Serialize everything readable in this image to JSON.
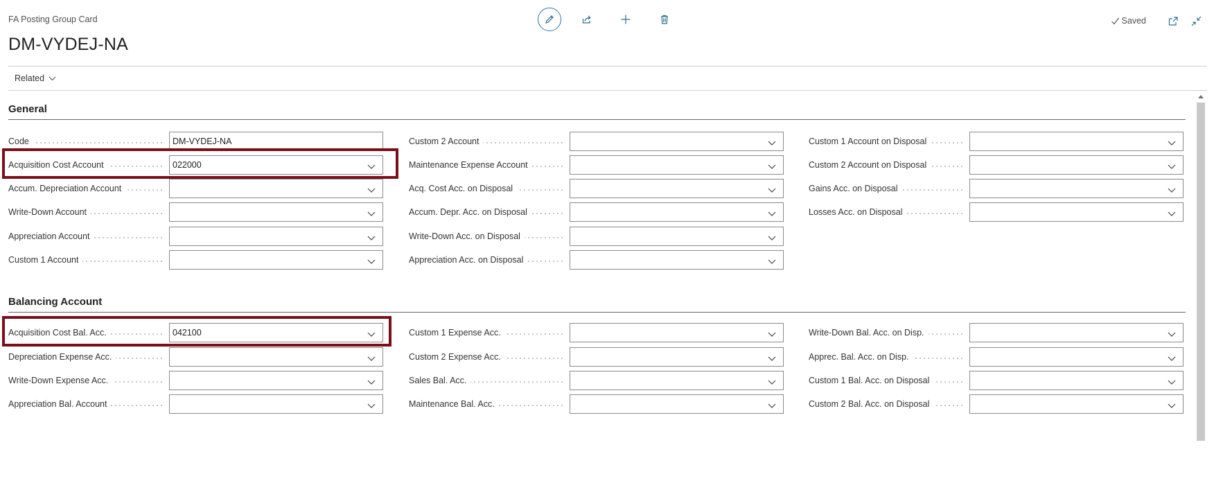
{
  "header": {
    "caption": "FA Posting Group Card",
    "title": "DM-VYDEJ-NA",
    "saved_label": "Saved"
  },
  "nav": {
    "related_label": "Related"
  },
  "general": {
    "title": "General",
    "col1": [
      {
        "label": "Code",
        "value": "DM-VYDEJ-NA",
        "dropdown": false
      },
      {
        "label": "Acquisition Cost Account",
        "value": "022000",
        "dropdown": true
      },
      {
        "label": "Accum. Depreciation Account",
        "value": "",
        "dropdown": true
      },
      {
        "label": "Write-Down Account",
        "value": "",
        "dropdown": true
      },
      {
        "label": "Appreciation Account",
        "value": "",
        "dropdown": true
      },
      {
        "label": "Custom 1 Account",
        "value": "",
        "dropdown": true
      }
    ],
    "col2": [
      {
        "label": "Custom 2 Account",
        "value": "",
        "dropdown": true
      },
      {
        "label": "Maintenance Expense Account",
        "value": "",
        "dropdown": true
      },
      {
        "label": "Acq. Cost Acc. on Disposal",
        "value": "",
        "dropdown": true
      },
      {
        "label": "Accum. Depr. Acc. on Disposal",
        "value": "",
        "dropdown": true
      },
      {
        "label": "Write-Down Acc. on Disposal",
        "value": "",
        "dropdown": true
      },
      {
        "label": "Appreciation Acc. on Disposal",
        "value": "",
        "dropdown": true
      }
    ],
    "col3": [
      {
        "label": "Custom 1 Account on Disposal",
        "value": "",
        "dropdown": true
      },
      {
        "label": "Custom 2 Account on Disposal",
        "value": "",
        "dropdown": true
      },
      {
        "label": "Gains Acc. on Disposal",
        "value": "",
        "dropdown": true
      },
      {
        "label": "Losses Acc. on Disposal",
        "value": "",
        "dropdown": true
      }
    ]
  },
  "balancing": {
    "title": "Balancing Account",
    "col1": [
      {
        "label": "Acquisition Cost Bal. Acc.",
        "value": "042100",
        "dropdown": true
      },
      {
        "label": "Depreciation Expense Acc.",
        "value": "",
        "dropdown": true
      },
      {
        "label": "Write-Down Expense Acc.",
        "value": "",
        "dropdown": true
      },
      {
        "label": "Appreciation Bal. Account",
        "value": "",
        "dropdown": true
      }
    ],
    "col2": [
      {
        "label": "Custom 1 Expense Acc.",
        "value": "",
        "dropdown": true
      },
      {
        "label": "Custom 2 Expense Acc.",
        "value": "",
        "dropdown": true
      },
      {
        "label": "Sales Bal. Acc.",
        "value": "",
        "dropdown": true
      },
      {
        "label": "Maintenance Bal. Acc.",
        "value": "",
        "dropdown": true
      }
    ],
    "col3": [
      {
        "label": "Write-Down Bal. Acc. on Disp.",
        "value": "",
        "dropdown": true
      },
      {
        "label": "Apprec. Bal. Acc. on Disp.",
        "value": "",
        "dropdown": true
      },
      {
        "label": "Custom 1 Bal. Acc. on Disposal",
        "value": "",
        "dropdown": true
      },
      {
        "label": "Custom 2 Bal. Acc. on Disposal",
        "value": "",
        "dropdown": true
      }
    ]
  },
  "colors": {
    "highlight": "#7a0f1a",
    "accent": "#2b6f8e"
  }
}
